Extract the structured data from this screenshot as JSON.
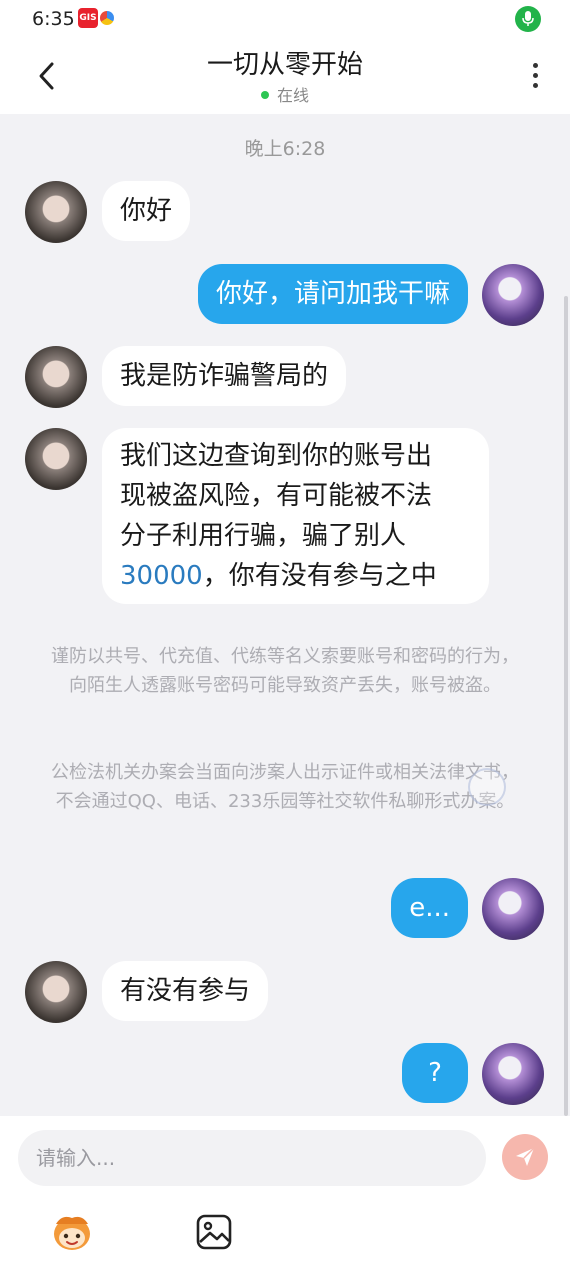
{
  "status_bar": {
    "time": "6:35",
    "badge_text": "GIS",
    "mic_icon": "mic-icon"
  },
  "header": {
    "title": "一切从零开始",
    "status": "在线",
    "status_color": "#2dc653",
    "back_icon": "chevron-left-icon",
    "more_icon": "more-vertical-icon"
  },
  "chat": {
    "timestamp": "晚上6:28",
    "messages": [
      {
        "from": "other",
        "text": "你好"
      },
      {
        "from": "self",
        "text": "你好，请问加我干嘛"
      },
      {
        "from": "other",
        "text": "我是防诈骗警局的"
      },
      {
        "from": "other",
        "lines": [
          "我们这边查询到你的账号出",
          "现被盗风险，有可能被不法",
          "分子利用行骗，骗了别人"
        ],
        "amount": "30000",
        "tail": "，你有没有参与之中"
      },
      {
        "from": "self",
        "text": "e..."
      },
      {
        "from": "other",
        "text": "有没有参与"
      },
      {
        "from": "self",
        "text": "?"
      }
    ],
    "notices": [
      "谨防以共号、代充值、代练等名义索要账号和密码的行为，向陌生人透露账号密码可能导致资产丢失，账号被盗。",
      "公检法机关办案会当面向涉案人出示证件或相关法律文书，不会通过QQ、电话、233乐园等社交软件私聊形式办案。"
    ],
    "bubble_out_color": "#27a6ec",
    "bubble_in_color": "#ffffff"
  },
  "input": {
    "placeholder": "请输入...",
    "value": "",
    "send_icon": "send-icon",
    "emoji_icon": "emoji-icon",
    "image_icon": "image-icon"
  }
}
